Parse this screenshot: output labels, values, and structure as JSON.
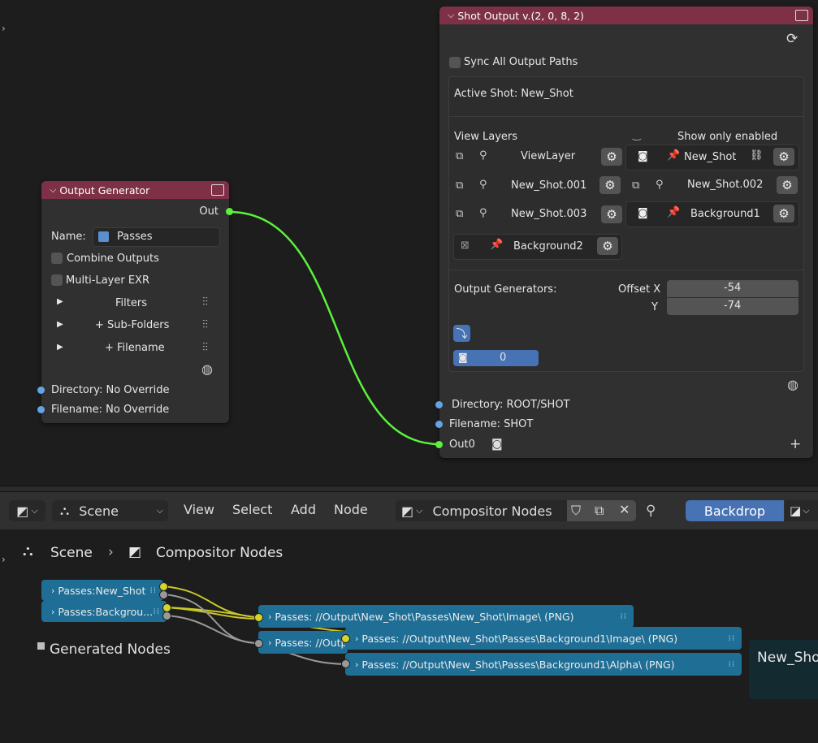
{
  "output_generator": {
    "title": "Output Generator",
    "out_label": "Out",
    "name_label": "Name:",
    "name_value": "Passes",
    "combine_outputs": "Combine Outputs",
    "multilayer_exr": "Multi-Layer EXR",
    "filters": "Filters",
    "subfolders": "+ Sub-Folders",
    "filename": "+ Filename",
    "directory_input": "Directory: No Override",
    "filename_input": "Filename: No Override"
  },
  "shot_output": {
    "title": "Shot Output v.(2, 0, 8, 2)",
    "sync_paths": "Sync All Output Paths",
    "active_shot": "Active Shot: New_Shot",
    "view_layers_label": "View Layers",
    "show_only_enabled": "Show only enabled",
    "layers": [
      "ViewLayer",
      "New_Shot",
      "New_Shot.001",
      "New_Shot.002",
      "New_Shot.003",
      "Background1",
      "Background2"
    ],
    "output_generators_label": "Output Generators:",
    "offset_x_label": "Offset X",
    "offset_x_value": "-54",
    "offset_y_label": "Y",
    "offset_y_value": "-74",
    "counter_value": "0",
    "directory_input": "Directory: ROOT/SHOT",
    "filename_input": "Filename: SHOT",
    "out0_label": "Out0",
    "add_glyph": "+"
  },
  "header": {
    "scene": "Scene",
    "menus": [
      "View",
      "Select",
      "Add",
      "Node"
    ],
    "tree_name": "Compositor Nodes",
    "backdrop": "Backdrop"
  },
  "breadcrumb": {
    "scene": "Scene",
    "tree": "Compositor Nodes"
  },
  "lower_nodes": {
    "in1": "Passes:New_Shot",
    "in2": "Passes:Backgrou...",
    "out1": "Passes: //Output\\New_Shot\\Passes\\New_Shot\\Image\\ (PNG)",
    "out2": "Passes: //Outp",
    "out3": "Passes: //Output\\New_Shot\\Passes\\Background1\\Image\\ (PNG)",
    "out4": "Passes: //Output\\New_Shot\\Passes\\Background1\\Alpha\\ (PNG)",
    "frame_label": "Generated Nodes",
    "side_node": "New_Sho"
  },
  "colors": {
    "node_header": "#7d3046",
    "link_green": "#5bf13c",
    "accent_blue": "#4772b3",
    "lower_node": "#1f6e95"
  }
}
